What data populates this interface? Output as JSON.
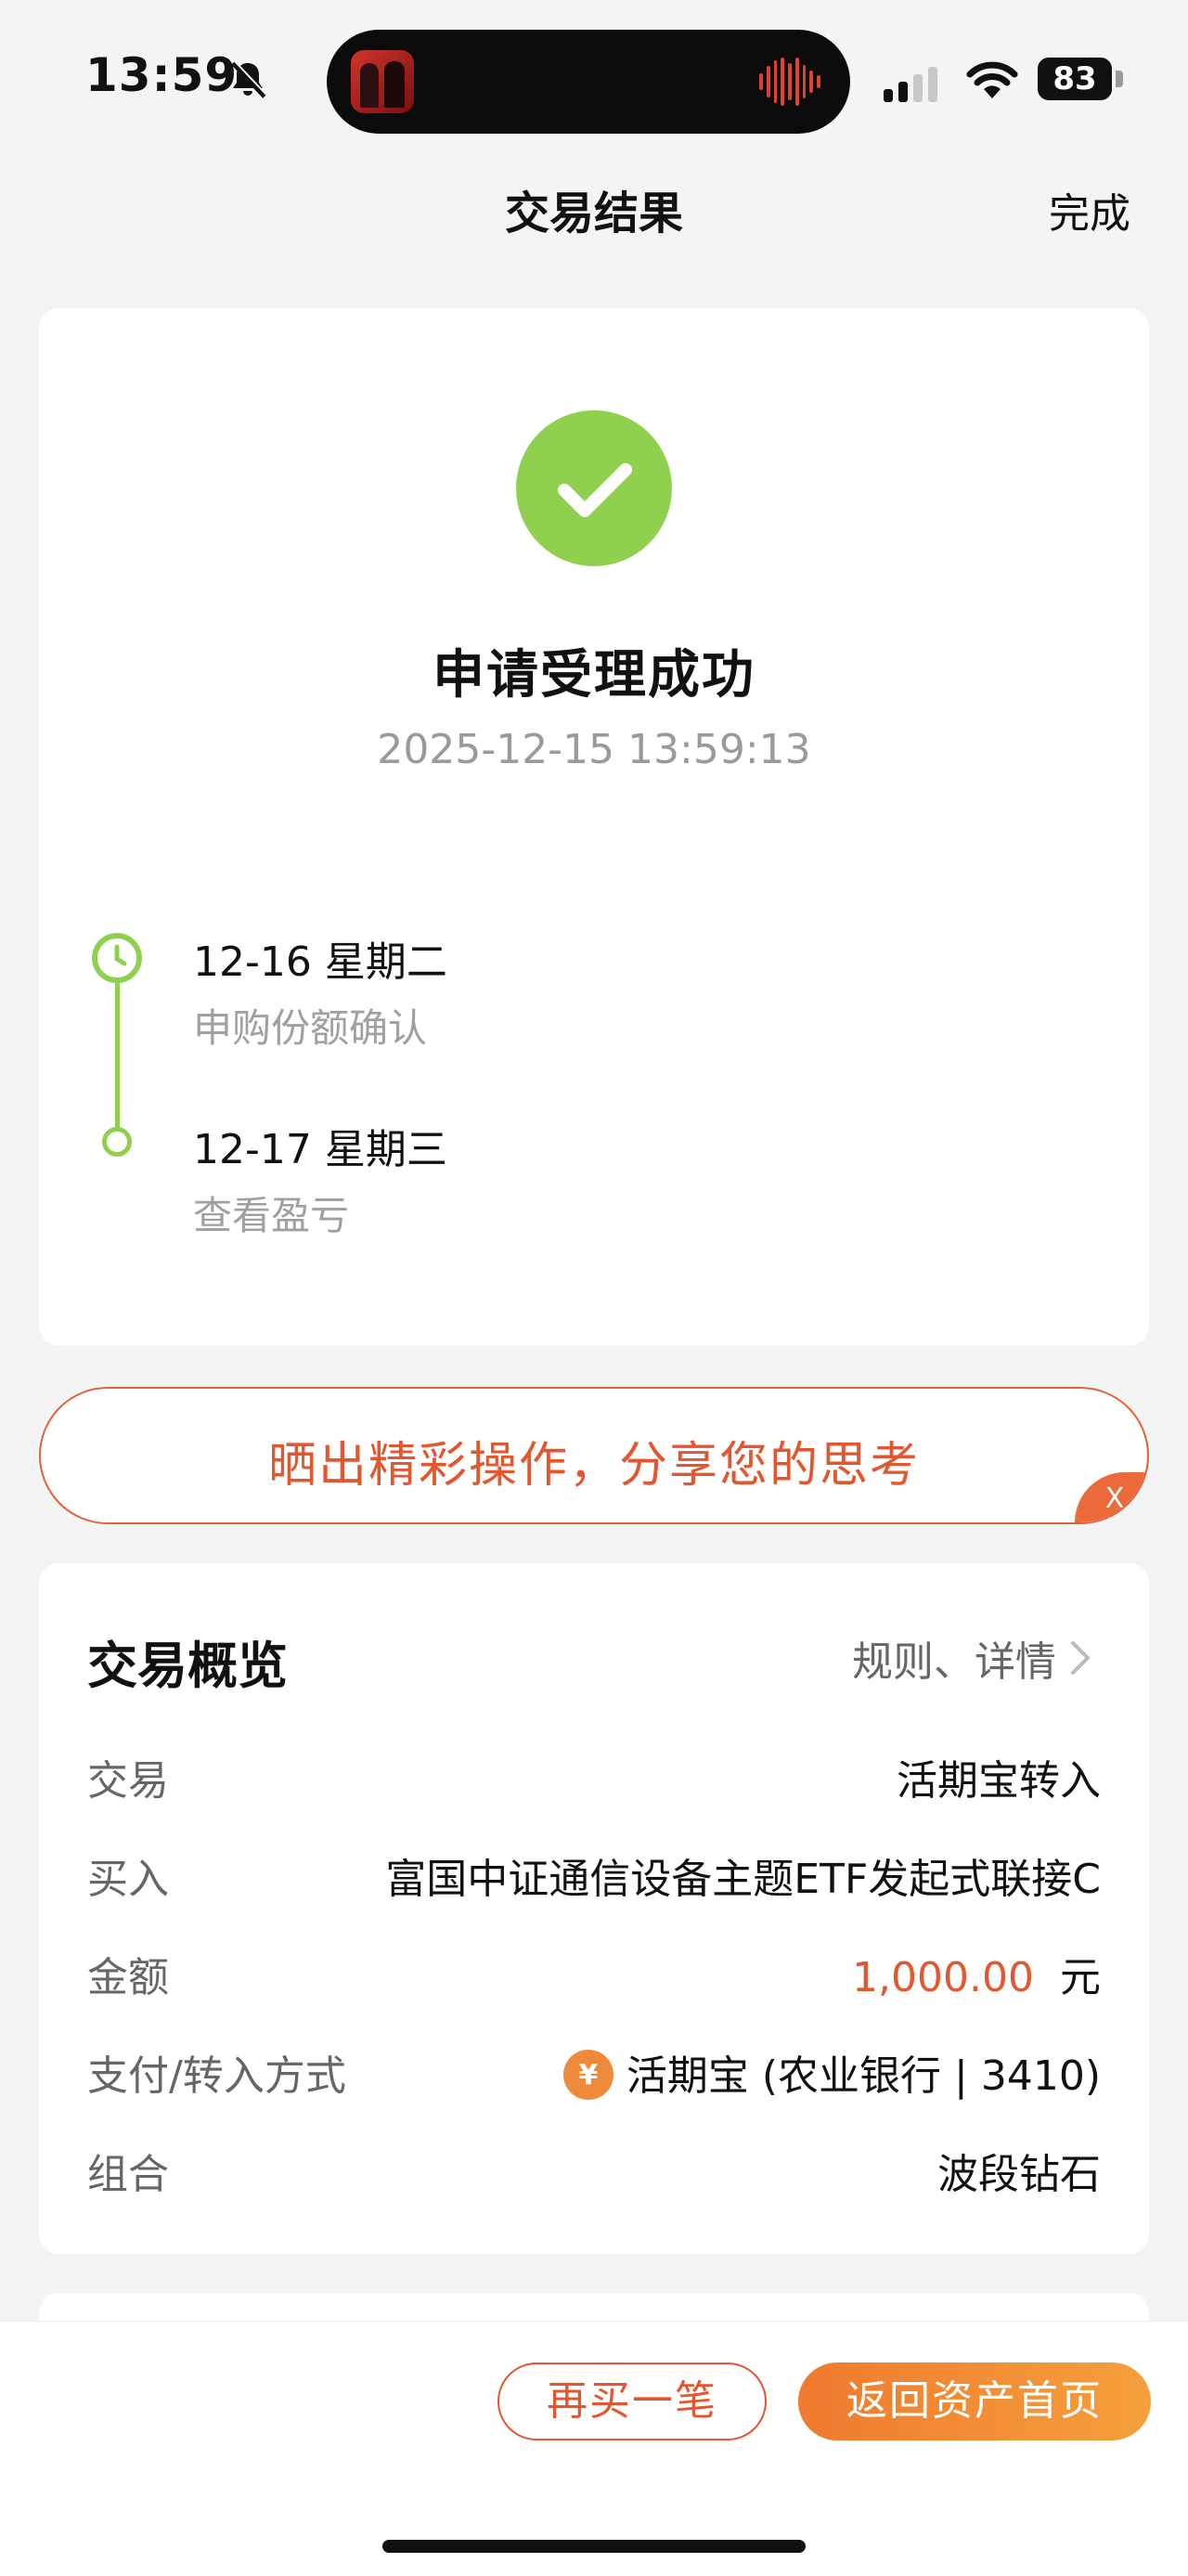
{
  "status_bar": {
    "time": "13:59",
    "battery": "83",
    "icons": [
      "bell-muted-icon",
      "signal-icon",
      "wifi-icon",
      "battery-icon"
    ]
  },
  "nav": {
    "title": "交易结果",
    "done_label": "完成"
  },
  "result": {
    "icon": "check-circle-icon",
    "title": "申请受理成功",
    "time": "2025-12-15 13:59:13"
  },
  "timeline": [
    {
      "date": "12-16  星期二",
      "desc": "申购份额确认"
    },
    {
      "date": "12-17  星期三",
      "desc": "查看盈亏"
    }
  ],
  "share_banner": {
    "text": "晒出精彩操作，分享您的思考",
    "close_label": "X"
  },
  "overview": {
    "title": "交易概览",
    "rules_link": "规则、详情",
    "rows": [
      {
        "label": "交易",
        "value": "活期宝转入"
      },
      {
        "label": "买入",
        "value": "富国中证通信设备主题ETF发起式联接C"
      },
      {
        "label": "金额",
        "amount": "1,000.00",
        "unit": "元"
      },
      {
        "label": "支付/转入方式",
        "pay_icon_glyph": "¥",
        "value": "活期宝 (农业银行 | 3410)"
      },
      {
        "label": "组合",
        "value": "波段钻石"
      }
    ]
  },
  "bottom_bar": {
    "buy_again_label": "再买一笔",
    "home_label": "返回资产首页"
  },
  "colors": {
    "accent": "#e2572f",
    "success": "#8fd14f",
    "background": "#f4f4f4"
  }
}
